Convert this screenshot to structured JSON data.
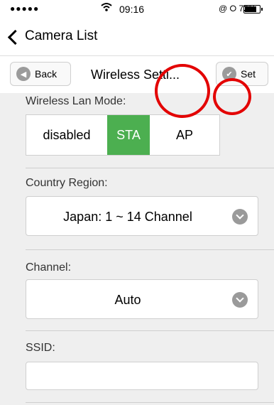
{
  "status_bar": {
    "signal": "●●●●●",
    "time": "09:16",
    "right_icons": "@ ⭘ 72%",
    "battery_percent": 72
  },
  "nav": {
    "back_label": "Camera List"
  },
  "toolbar": {
    "back_label": "Back",
    "title": "Wireless Setti...",
    "set_label": "Set"
  },
  "wireless_mode": {
    "label": "Wireless Lan Mode:",
    "options": [
      "disabled",
      "STA",
      "AP"
    ],
    "selected": "STA"
  },
  "country_region": {
    "label": "Country Region:",
    "value": "Japan: 1 ~ 14 Channel"
  },
  "channel": {
    "label": "Channel:",
    "value": "Auto"
  },
  "ssid": {
    "label": "SSID:",
    "value": ""
  },
  "colors": {
    "accent": "#4caf50",
    "annotation": "#e30000"
  }
}
